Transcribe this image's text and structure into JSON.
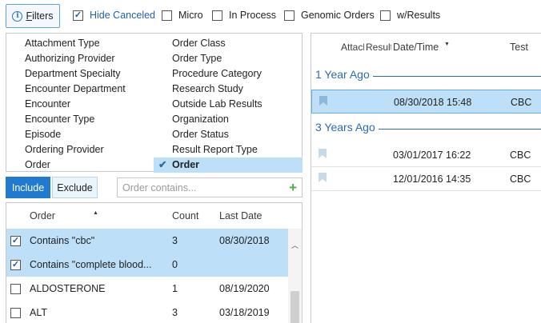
{
  "toolbar": {
    "filters_label": "Filters",
    "options": [
      {
        "label": "Hide Canceled",
        "checked": true
      },
      {
        "label": "Micro",
        "checked": false
      },
      {
        "label": "In Process",
        "checked": false
      },
      {
        "label": "Genomic Orders",
        "checked": false
      },
      {
        "label": "w/Results",
        "checked": false
      }
    ]
  },
  "criteria": {
    "left": [
      "Attachment Type",
      "Authorizing Provider",
      "Department Specialty",
      "Encounter Department",
      "Encounter",
      "Encounter Type",
      "Episode",
      "Ordering Provider",
      "Order"
    ],
    "right": [
      "Order Class",
      "Order Type",
      "Procedure Category",
      "Research Study",
      "Outside Lab Results",
      "Organization",
      "Order Status",
      "Result Report Type",
      "Order"
    ],
    "selected_right_index": 8
  },
  "mode": {
    "include_label": "Include",
    "exclude_label": "Exclude",
    "search_placeholder": "Order contains..."
  },
  "order_table": {
    "headers": {
      "order": "Order",
      "count": "Count",
      "last_date": "Last Date"
    },
    "rows": [
      {
        "order": "Contains \"cbc\"",
        "count": "3",
        "last_date": "08/30/2018",
        "checked": true,
        "selected": true
      },
      {
        "order": "Contains \"complete blood...",
        "count": "0",
        "last_date": "",
        "checked": true,
        "selected": true
      },
      {
        "order": "ALDOSTERONE",
        "count": "1",
        "last_date": "08/19/2020",
        "checked": false,
        "selected": false
      },
      {
        "order": "ALT",
        "count": "3",
        "last_date": "03/18/2019",
        "checked": false,
        "selected": false
      }
    ]
  },
  "results": {
    "headers": {
      "attach": "Attachment",
      "result": "Result",
      "date": "Date/Time",
      "test": "Test"
    },
    "groups": [
      {
        "label": "1 Year Ago",
        "rows": [
          {
            "date": "08/30/2018 15:48",
            "test": "CBC",
            "selected": true
          }
        ]
      },
      {
        "label": "3 Years Ago",
        "rows": [
          {
            "date": "03/01/2017 16:22",
            "test": "CBC",
            "selected": false
          },
          {
            "date": "12/01/2016 14:35",
            "test": "CBC",
            "selected": false
          }
        ]
      }
    ]
  },
  "colors": {
    "accent": "#1f7ad0",
    "selection": "#bddff7",
    "group_label": "#2c6bb0",
    "add": "#4cae4c"
  }
}
